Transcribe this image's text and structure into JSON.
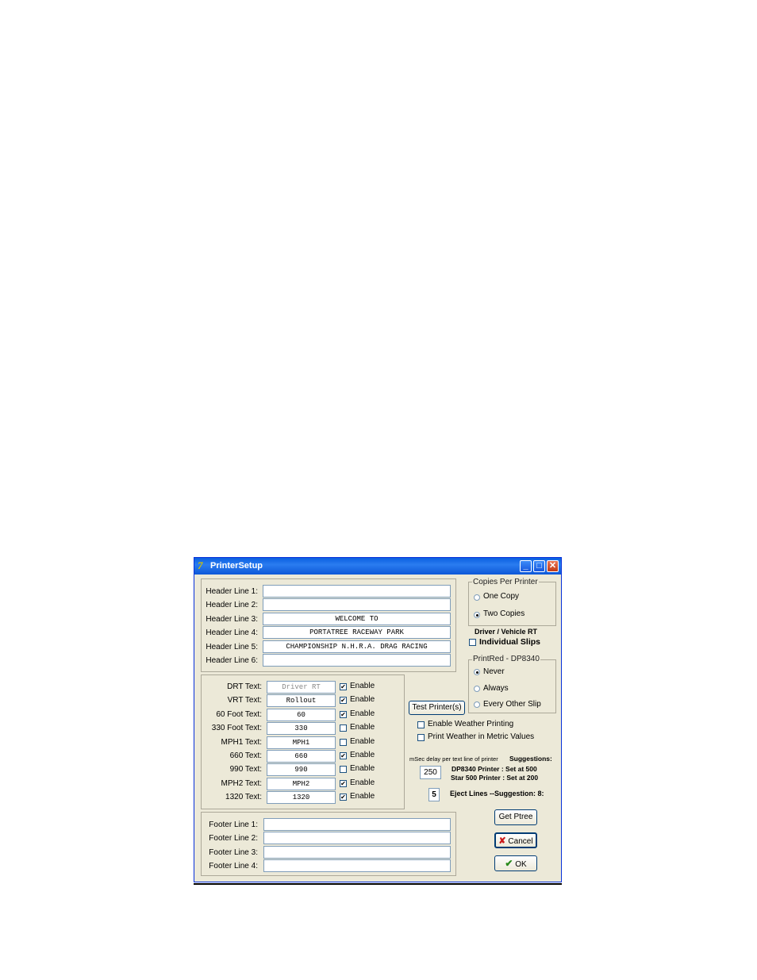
{
  "window": {
    "title": "PrinterSetup"
  },
  "header_lines": [
    {
      "label": "Header Line 1:",
      "value": ""
    },
    {
      "label": "Header Line 2:",
      "value": ""
    },
    {
      "label": "Header Line 3:",
      "value": "WELCOME TO"
    },
    {
      "label": "Header Line 4:",
      "value": "PORTATREE RACEWAY PARK"
    },
    {
      "label": "Header Line 5:",
      "value": "CHAMPIONSHIP N.H.R.A. DRAG RACING"
    },
    {
      "label": "Header Line 6:",
      "value": ""
    }
  ],
  "text_rows": [
    {
      "label": "DRT Text:",
      "value": "Driver RT",
      "enabled": true
    },
    {
      "label": "VRT Text:",
      "value": "Rollout",
      "enabled": true
    },
    {
      "label": "60 Foot Text:",
      "value": "60",
      "enabled": true
    },
    {
      "label": "330 Foot Text:",
      "value": "330",
      "enabled": false
    },
    {
      "label": "MPH1 Text:",
      "value": "MPH1",
      "enabled": false
    },
    {
      "label": "660 Text:",
      "value": "660",
      "enabled": true
    },
    {
      "label": "990 Text:",
      "value": "990",
      "enabled": false
    },
    {
      "label": "MPH2 Text:",
      "value": "MPH2",
      "enabled": true
    },
    {
      "label": "1320 Text:",
      "value": "1320",
      "enabled": true
    }
  ],
  "enable_label": "Enable",
  "footer_lines": [
    {
      "label": "Footer Line 1:",
      "value": ""
    },
    {
      "label": "Footer Line 2:",
      "value": ""
    },
    {
      "label": "Footer Line 3:",
      "value": ""
    },
    {
      "label": "Footer Line 4:",
      "value": ""
    }
  ],
  "copies": {
    "legend": "Copies Per Printer",
    "options": [
      "One Copy",
      "Two Copies"
    ],
    "selected": "Two Copies"
  },
  "driver_vehicle": {
    "title": "Driver / Vehicle RT",
    "individual_slips": "Individual Slips",
    "checked": false
  },
  "printred": {
    "legend": "PrintRed - DP8340",
    "options": [
      "Never",
      "Always",
      "Every Other Slip"
    ],
    "selected": "Never"
  },
  "test_printer_label": "Test Printer(s)",
  "enable_weather_label": "Enable Weather Printing",
  "enable_weather_checked": false,
  "metric_label": "Print Weather in Metric Values",
  "metric_checked": false,
  "delay": {
    "label": "mSec delay per text line of printer",
    "value": "250",
    "suggestions_title": "Suggestions:",
    "dp8340": "DP8340 Printer : Set at 500",
    "star500": "Star 500 Printer : Set at 200"
  },
  "eject": {
    "value": "5",
    "label": "Eject Lines --Suggestion: 8:"
  },
  "buttons": {
    "get_ptree": "Get Ptree",
    "cancel": "Cancel",
    "ok": "OK"
  },
  "colors": {
    "titlebar": "#0a5fe0",
    "dialog_bg": "#ece9d8",
    "check_green": "#2a8a1c",
    "cancel_red": "#cc1a1a"
  }
}
